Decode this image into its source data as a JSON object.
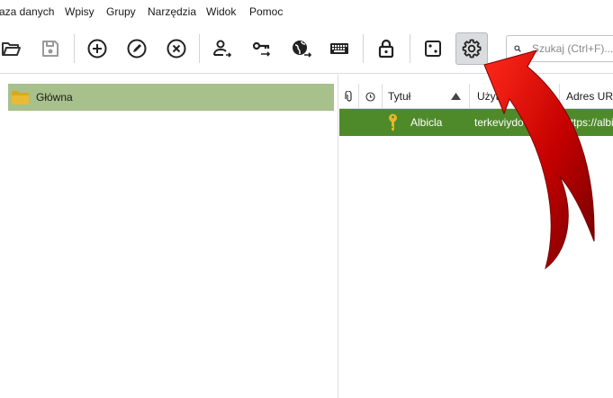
{
  "menu": {
    "database": "aza danych",
    "entries": "Wpisy",
    "groups": "Grupy",
    "tools": "Narzędzia",
    "view": "Widok",
    "help": "Pomoc"
  },
  "toolbar": {
    "buttons": [
      "open-database",
      "save-database",
      "add-entry",
      "edit-entry",
      "delete-entry",
      "copy-username",
      "copy-password",
      "open-url",
      "autotype",
      "lock-database",
      "password-generator",
      "settings"
    ],
    "active_button": "settings"
  },
  "search": {
    "placeholder": "Szukaj (Ctrl+F)..."
  },
  "groups": {
    "items": [
      {
        "label": "Główna"
      }
    ]
  },
  "entries": {
    "columns": [
      "",
      "",
      "Tytuł",
      "Użytkownik",
      "Adres URL"
    ],
    "rows": [
      {
        "title": "Albicla",
        "username": "terkeviydo@biy...",
        "url": "https://albicla"
      }
    ]
  },
  "colors": {
    "selected_group": "#a8c08c",
    "selected_entry": "#4e8a2a",
    "annotation_arrow": "#c40000"
  }
}
